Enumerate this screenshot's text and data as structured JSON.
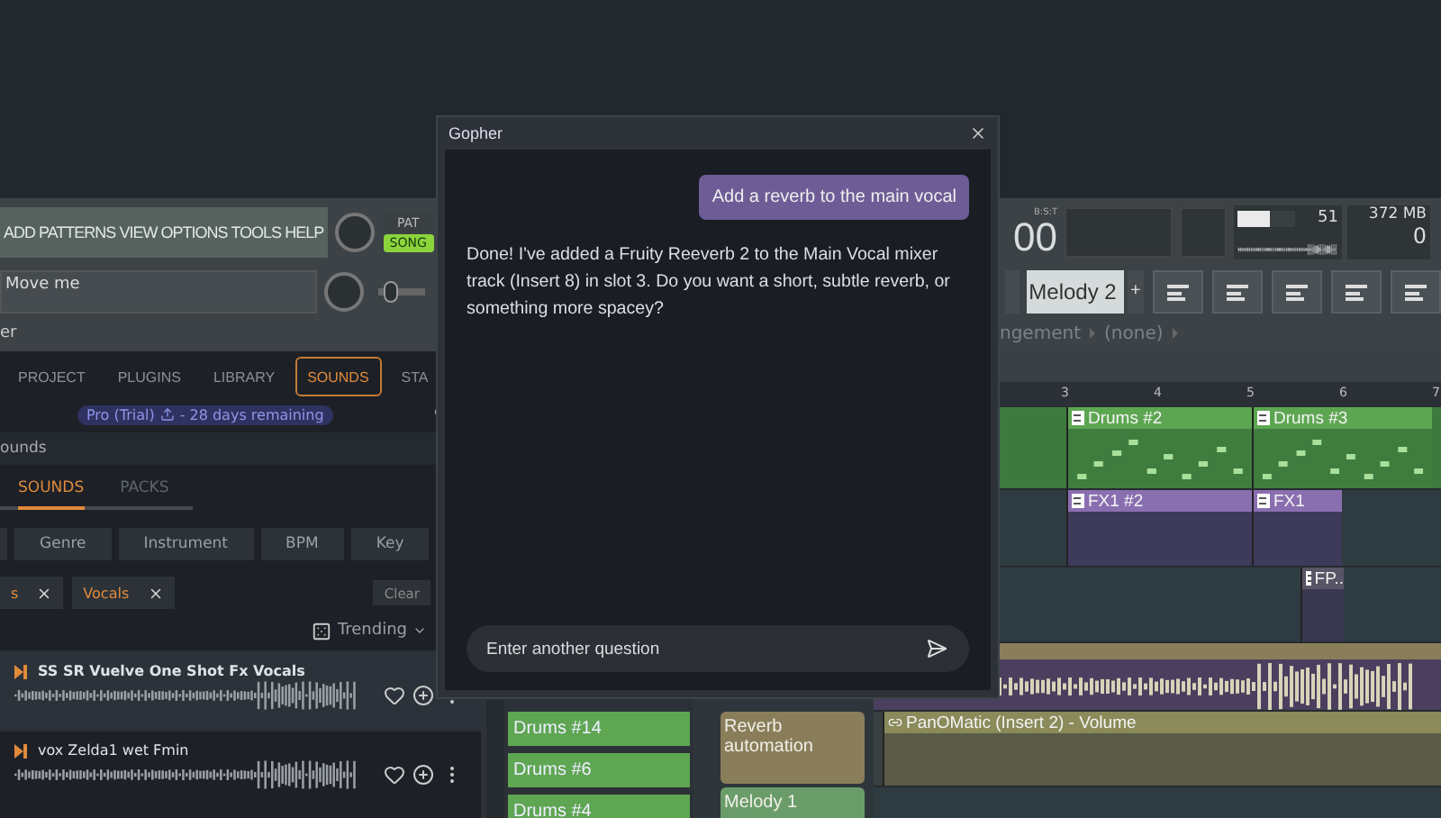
{
  "menu": [
    "ADD",
    "PATTERNS",
    "VIEW",
    "OPTIONS",
    "TOOLS",
    "HELP"
  ],
  "hint_bar": {
    "text": "Move me"
  },
  "slider": {
    "level": 0.1
  },
  "mode_switch": [
    {
      "label": "PAT",
      "selected": false
    },
    {
      "label": "SONG",
      "selected": true
    }
  ],
  "transport": {
    "time_unit": "B:S:T",
    "time": "00"
  },
  "monitor": {
    "cpu_meter": {
      "level": 0.55
    },
    "cpu": "51",
    "memory": "372 MB",
    "polyphony": "0"
  },
  "pattern_selector": {
    "value": "Melody 2",
    "add_label": "+"
  },
  "browser": {
    "title": "er",
    "tabs": [
      {
        "label": "PROJECT",
        "selected": false
      },
      {
        "label": "PLUGINS",
        "selected": false
      },
      {
        "label": "LIBRARY",
        "selected": false
      },
      {
        "label": "SOUNDS",
        "selected": true
      },
      {
        "label": "STA",
        "selected": false
      }
    ],
    "plan_badge": {
      "plan": "Pro (Trial)",
      "remaining": "- 28 days remaining"
    },
    "section_title": "ounds",
    "sub_tabs": [
      {
        "label": "SOUNDS",
        "selected": true
      },
      {
        "label": "PACKS",
        "selected": false
      }
    ],
    "filters": [
      "Genre",
      "Instrument",
      "BPM",
      "Key"
    ],
    "chips": [
      {
        "label": "s"
      },
      {
        "label": "Vocals"
      }
    ],
    "clear_button": "Clear",
    "sort": "Trending",
    "samples": [
      {
        "name": "SS SR Vuelve One Shot Fx Vocals",
        "selected": true
      },
      {
        "name": "vox Zelda1 wet Fmin",
        "selected": false
      }
    ]
  },
  "playlist": {
    "breadcrumb": [
      "ngement",
      "(none)"
    ],
    "ruler": [
      "3",
      "4",
      "5",
      "6",
      "7"
    ],
    "picker": [
      "Drums #14",
      "Drums #6",
      "Drums #4"
    ],
    "track_headers": [
      {
        "label": "Reverb automation",
        "kind": "automation"
      },
      {
        "label": "Melody 1",
        "kind": "pattern"
      }
    ],
    "tracks": [
      {
        "kind": "drums",
        "clips": [
          {
            "label": "Drums #2"
          },
          {
            "label": "Drums #3"
          }
        ]
      },
      {
        "kind": "fx",
        "clips": [
          {
            "label": "FX1 #2"
          },
          {
            "label": "FX1"
          }
        ]
      },
      {
        "kind": "sample",
        "clips": [
          {
            "label": "FP.."
          }
        ]
      },
      {
        "kind": "audio"
      },
      {
        "kind": "automation",
        "clips": [
          {
            "label": "PanOMatic (Insert 2) - Volume"
          }
        ]
      },
      {
        "kind": "empty"
      }
    ]
  },
  "dialog": {
    "title": "Gopher",
    "messages": [
      {
        "kind": "user",
        "text": "Add a reverb to the main vocal"
      },
      {
        "kind": "assistant",
        "text": "Done! I've added a Fruity Reeverb 2 to the Main Vocal mixer track (Insert 8) in slot 3. Do you want a short, subtle reverb, or something more spacey?"
      }
    ],
    "input": {
      "placeholder": "Enter another question"
    }
  }
}
